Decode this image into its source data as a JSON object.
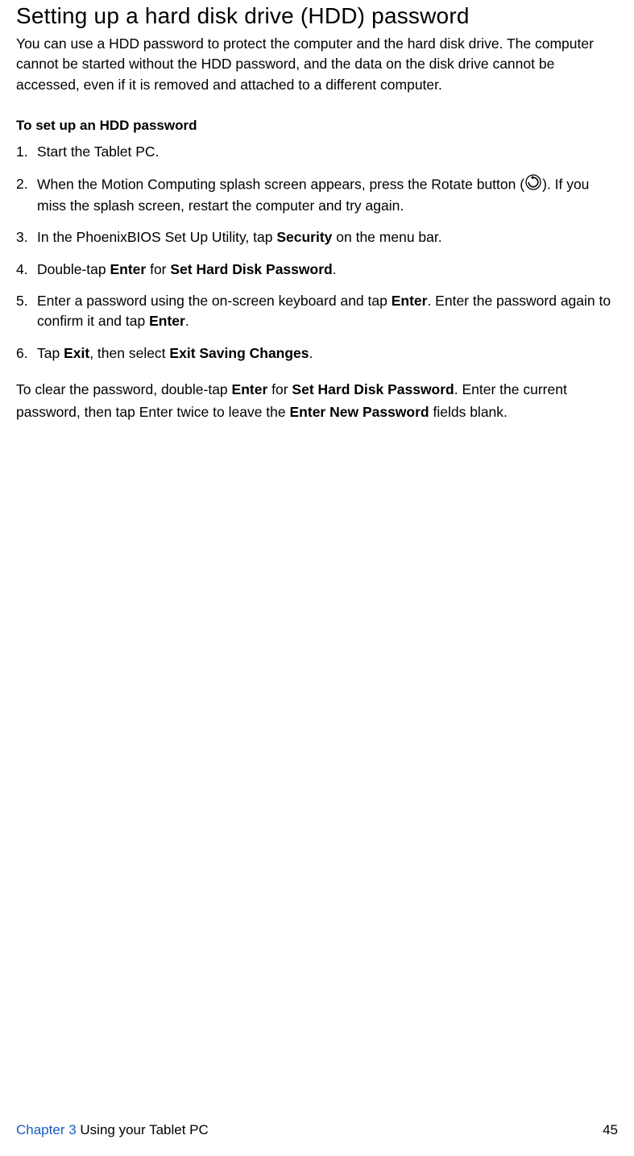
{
  "title": "Setting up a hard disk drive (HDD) password",
  "intro": "You can use a HDD password to protect the computer and the hard disk drive. The computer cannot be started without the HDD password, and the data on the disk drive cannot be accessed, even if it is removed and attached to a different computer.",
  "subhead": "To set up an HDD password",
  "steps": {
    "s1": "Start the Tablet PC.",
    "s2a": "When the Motion Computing splash screen appears, press the Rotate button (",
    "s2b": "). If you miss the splash screen, restart the computer and try again.",
    "s3a": "In the PhoenixBIOS Set Up Utility, tap ",
    "s3b": "Security",
    "s3c": " on the menu bar.",
    "s4a": "Double-tap ",
    "s4b": "Enter",
    "s4c": " for ",
    "s4d": "Set Hard Disk Password",
    "s4e": ".",
    "s5a": "Enter a password using the on-screen keyboard and tap ",
    "s5b": "Enter",
    "s5c": ". Enter the password again to confirm it and tap ",
    "s5d": "Enter",
    "s5e": ".",
    "s6a": "Tap ",
    "s6b": "Exit",
    "s6c": ", then select ",
    "s6d": "Exit Saving Changes",
    "s6e": "."
  },
  "clear": {
    "a": "To clear the password, double-tap ",
    "b": "Enter",
    "c": " for ",
    "d": "Set Hard Disk Password",
    "e": ". Enter the current password, then tap Enter twice to leave the ",
    "f": "Enter New Password",
    "g": " fields blank."
  },
  "footer": {
    "chapter_link": "Chapter 3",
    "chapter_rest": "  Using your Tablet PC",
    "page": "45"
  }
}
